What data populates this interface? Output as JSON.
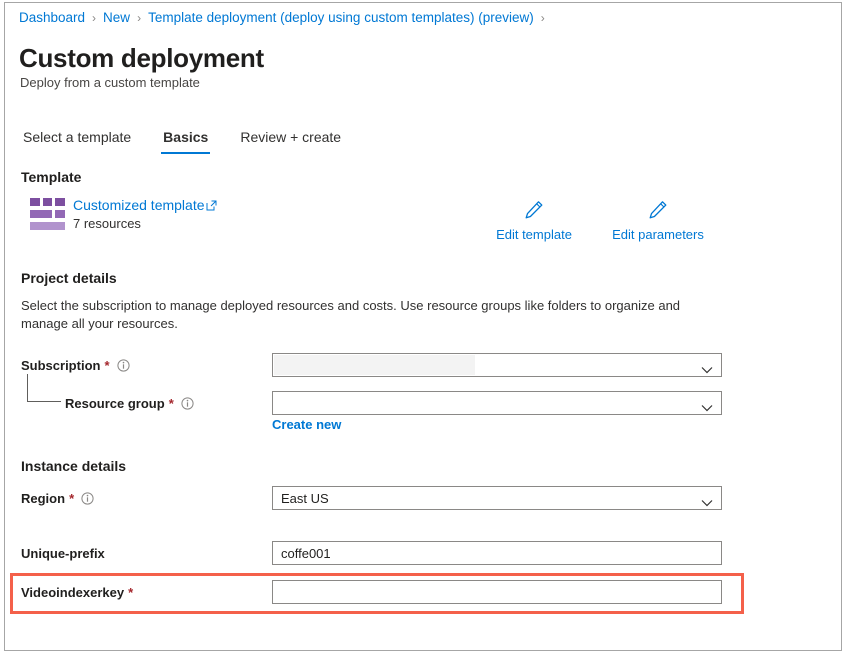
{
  "breadcrumb": {
    "items": [
      {
        "label": "Dashboard"
      },
      {
        "label": "New"
      },
      {
        "label": "Template deployment (deploy using custom templates) (preview)"
      }
    ],
    "separator": "›"
  },
  "header": {
    "title": "Custom deployment",
    "subtitle": "Deploy from a custom template"
  },
  "tabs": [
    {
      "label": "Select a template",
      "active": false
    },
    {
      "label": "Basics",
      "active": true
    },
    {
      "label": "Review + create",
      "active": false
    }
  ],
  "template_section": {
    "heading": "Template",
    "icon": "template-grid-icon",
    "link_label": "Customized template",
    "external_icon": "external-link-icon",
    "resource_count": "7 resources",
    "actions": [
      {
        "label": "Edit template",
        "icon": "pencil-icon"
      },
      {
        "label": "Edit parameters",
        "icon": "pencil-icon"
      }
    ]
  },
  "project_details": {
    "heading": "Project details",
    "description": "Select the subscription to manage deployed resources and costs. Use resource groups like folders to organize and manage all your resources.",
    "subscription": {
      "label": "Subscription",
      "required": "*",
      "info_icon": "info-icon",
      "value": "",
      "redacted": true,
      "chevron_icon": "chevron-down-icon"
    },
    "resource_group": {
      "label": "Resource group",
      "required": "*",
      "info_icon": "info-icon",
      "value": "",
      "chevron_icon": "chevron-down-icon",
      "create_new_label": "Create new"
    }
  },
  "instance_details": {
    "heading": "Instance details",
    "region": {
      "label": "Region",
      "required": "*",
      "info_icon": "info-icon",
      "value": "East US",
      "chevron_icon": "chevron-down-icon"
    },
    "unique_prefix": {
      "label": "Unique-prefix",
      "required": "",
      "value": "coffe001"
    },
    "videoindexerkey": {
      "label": "Videoindexerkey",
      "required": "*",
      "value": "",
      "highlighted": true
    }
  },
  "colors": {
    "link": "#0078d4",
    "required_asterisk": "#a4262c",
    "annotation": "#f4604a",
    "template_icon_dark": "#7d4fa0",
    "template_icon_mid": "#9268b5",
    "template_icon_light": "#b193cd"
  }
}
